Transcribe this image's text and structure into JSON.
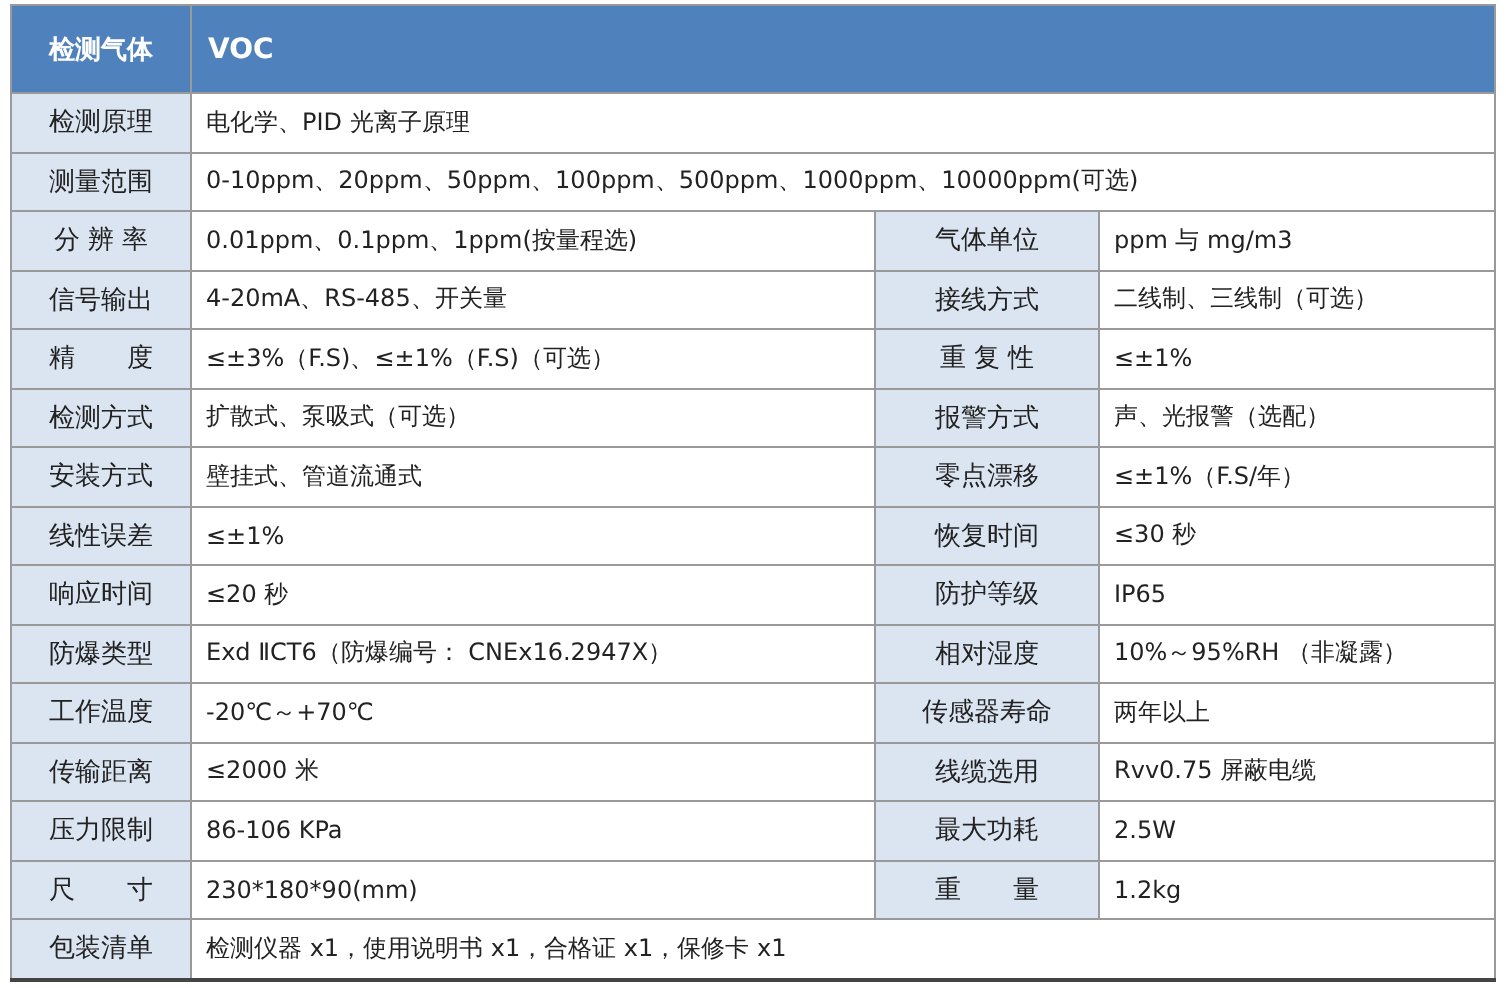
{
  "header": {
    "label": "检测气体",
    "value": "VOC"
  },
  "rows": [
    {
      "kind": "full",
      "label": "检测原理",
      "value": "电化学、PID 光离子原理"
    },
    {
      "kind": "full",
      "label": "测量范围",
      "value": "0-10ppm、20ppm、50ppm、100ppm、500ppm、1000ppm、10000ppm(可选)"
    },
    {
      "kind": "pair",
      "label": "分 辨 率",
      "value": "0.01ppm、0.1ppm、1ppm(按量程选)",
      "label2": "气体单位",
      "value2": "ppm 与 mg/m3"
    },
    {
      "kind": "pair",
      "label": "信号输出",
      "value": "4-20mA、RS-485、开关量",
      "label2": "接线方式",
      "value2": "二线制、三线制（可选）"
    },
    {
      "kind": "pair",
      "label": "精　　度",
      "value": "≤±3%（F.S)、≤±1%（F.S)（可选）",
      "label2": "重 复 性",
      "value2": "≤±1%"
    },
    {
      "kind": "pair",
      "label": "检测方式",
      "value": "扩散式、泵吸式（可选）",
      "label2": "报警方式",
      "value2": "声、光报警（选配）"
    },
    {
      "kind": "pair",
      "label": "安装方式",
      "value": "壁挂式、管道流通式",
      "label2": "零点漂移",
      "value2": "≤±1%（F.S/年）"
    },
    {
      "kind": "pair",
      "label": "线性误差",
      "value": "≤±1%",
      "label2": "恢复时间",
      "value2": "≤30 秒"
    },
    {
      "kind": "pair",
      "label": "响应时间",
      "value": "≤20 秒",
      "label2": "防护等级",
      "value2": "IP65"
    },
    {
      "kind": "pair",
      "label": "防爆类型",
      "value": "Exd ⅡCT6（防爆编号： CNEx16.2947X）",
      "label2": "相对湿度",
      "value2": "10%～95%RH （非凝露）"
    },
    {
      "kind": "pair",
      "label": "工作温度",
      "value": "-20℃～+70℃",
      "label2": "传感器寿命",
      "value2": "两年以上"
    },
    {
      "kind": "pair",
      "label": "传输距离",
      "value": "≤2000 米",
      "label2": "线缆选用",
      "value2": "Rvv0.75 屏蔽电缆"
    },
    {
      "kind": "pair",
      "label": "压力限制",
      "value": "86-106 KPa",
      "label2": "最大功耗",
      "value2": "2.5W"
    },
    {
      "kind": "pair",
      "label": "尺　　寸",
      "value": "230*180*90(mm)",
      "label2": "重　　量",
      "value2": "1.2kg"
    },
    {
      "kind": "full",
      "label": "包装清单",
      "value": "检测仪器 x1，使用说明书 x1，合格证 x1，保修卡 x1"
    }
  ]
}
